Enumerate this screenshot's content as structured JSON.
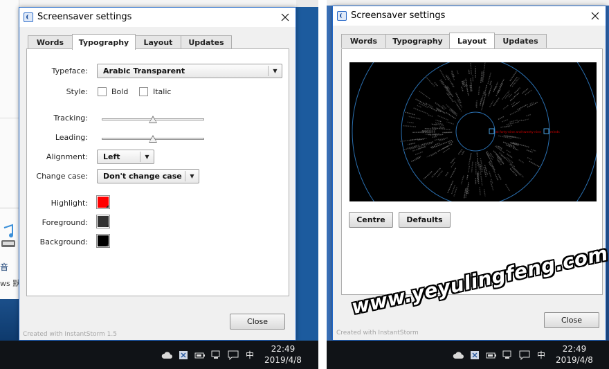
{
  "left_dialog": {
    "title": "Screensaver settings",
    "tabs": [
      {
        "label": "Words",
        "active": false
      },
      {
        "label": "Typography",
        "active": true
      },
      {
        "label": "Layout",
        "active": false
      },
      {
        "label": "Updates",
        "active": false
      }
    ],
    "typography": {
      "typeface_label": "Typeface:",
      "typeface_value": "Arabic Transparent",
      "style_label": "Style:",
      "bold_label": "Bold",
      "bold_checked": false,
      "italic_label": "Italic",
      "italic_checked": false,
      "tracking_label": "Tracking:",
      "tracking_level": 0.5,
      "leading_label": "Leading:",
      "leading_level": 0.5,
      "alignment_label": "Alignment:",
      "alignment_value": "Left",
      "change_case_label": "Change case:",
      "change_case_value": "Don't change case",
      "highlight_label": "Highlight:",
      "highlight_color": "#ff0000",
      "foreground_label": "Foreground:",
      "foreground_color": "#333333",
      "background_label": "Background:",
      "background_color": "#000000"
    },
    "close_label": "Close",
    "footer": "Created with InstantStorm 1.5"
  },
  "right_dialog": {
    "title": "Screensaver settings",
    "tabs": [
      {
        "label": "Words",
        "active": false
      },
      {
        "label": "Typography",
        "active": false
      },
      {
        "label": "Layout",
        "active": true
      },
      {
        "label": "Updates",
        "active": false
      }
    ],
    "preview": {
      "highlight_text": "at forty-nine and twenty-nine",
      "highlight_text_2": "minds",
      "ring_color": "#2a6fb0",
      "highlight_color": "#d80000"
    },
    "centre_label": "Centre",
    "defaults_label": "Defaults",
    "close_label": "Close",
    "footer": "Created with InstantStorm"
  },
  "taskbar": {
    "time": "22:49",
    "date": "2019/4/8",
    "ime": "中",
    "tray_icons": [
      "cloud-icon",
      "security-icon",
      "battery-icon",
      "network-icon",
      "notification-icon"
    ]
  },
  "background": {
    "left_snippet_1": "音",
    "left_snippet_2": "ws 默"
  },
  "watermark": "www.yeyulingfeng.com"
}
